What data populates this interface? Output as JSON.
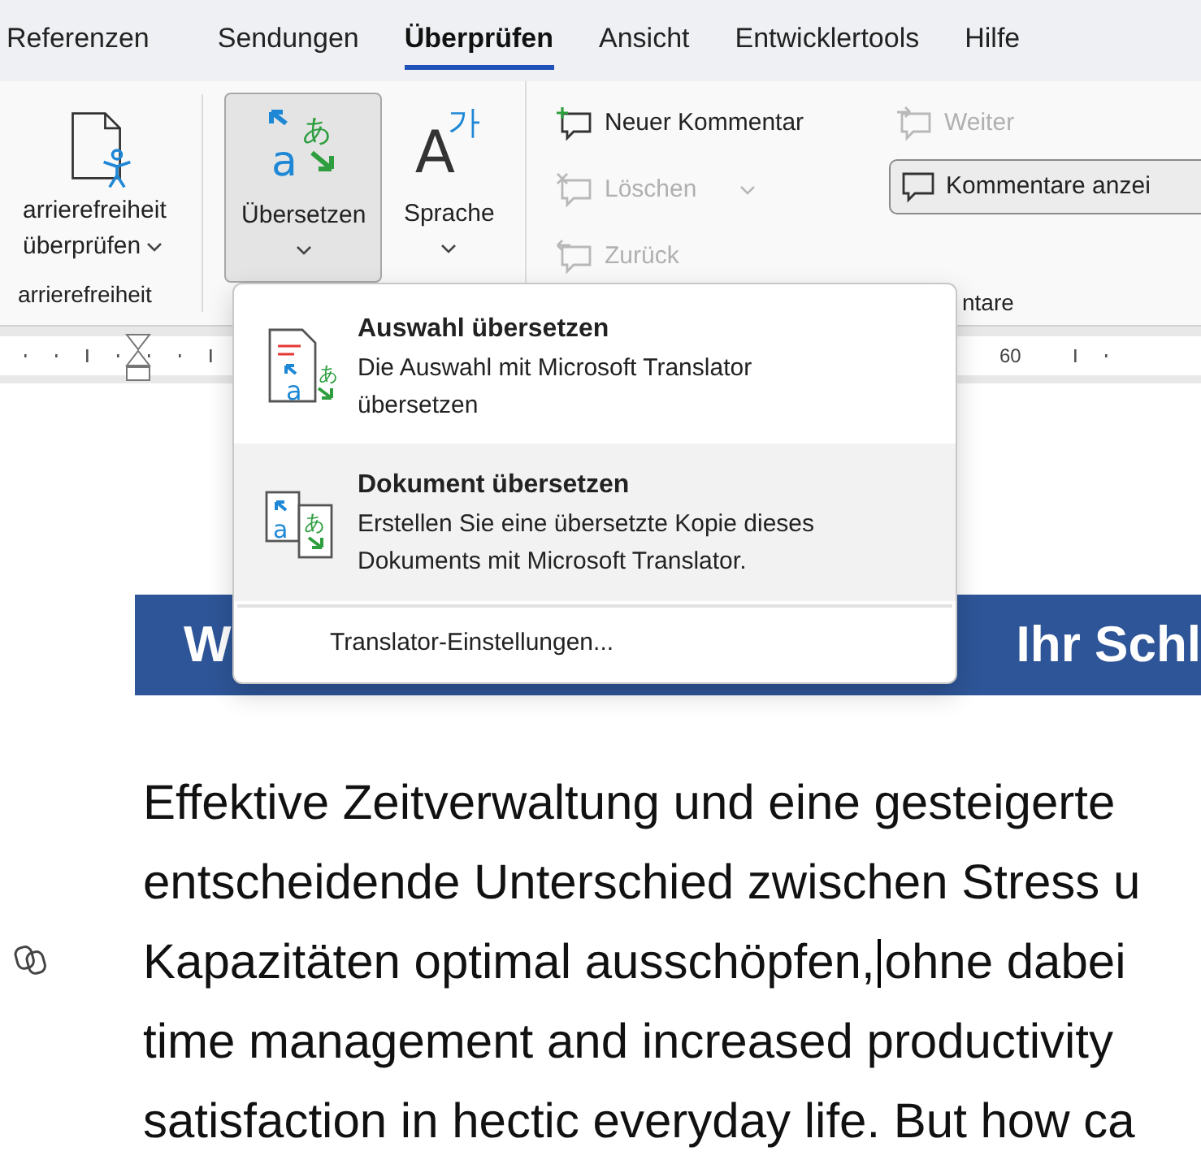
{
  "tabs": [
    {
      "label": "Referenzen",
      "selected": false
    },
    {
      "label": "Sendungen",
      "selected": false
    },
    {
      "label": "Überprüfen",
      "selected": true
    },
    {
      "label": "Ansicht",
      "selected": false
    },
    {
      "label": "Entwicklertools",
      "selected": false
    },
    {
      "label": "Hilfe",
      "selected": false
    }
  ],
  "ribbon": {
    "accessibility": {
      "label_line_1": "arrierefreiheit",
      "label_line_2": "überprüfen",
      "group_label": "arrierefreiheit"
    },
    "translate": {
      "label": "Übersetzen",
      "pressed": true,
      "icon_source": "a",
      "icon_target": "あ"
    },
    "language": {
      "label": "Sprache",
      "glyph": "가",
      "icon_letter": "A"
    },
    "comments": [
      {
        "kind": "new",
        "label": "Neuer Kommentar",
        "disabled": false
      },
      {
        "kind": "delete",
        "label": "Löschen",
        "disabled": true
      },
      {
        "kind": "back",
        "label": "Zurück",
        "disabled": true
      },
      {
        "kind": "next",
        "label": "Weiter",
        "disabled": true
      }
    ],
    "show_comments": {
      "label": "Kommentare anzei"
    },
    "comments_group_label": "ntare"
  },
  "ruler": {
    "tick_label": "60"
  },
  "menu": {
    "items": [
      {
        "kind": "selection",
        "title": "Auswahl übersetzen",
        "description": "Die Auswahl mit Microsoft Translator übersetzen",
        "selected": false,
        "icon_source": "a",
        "icon_target": "あ"
      },
      {
        "kind": "document",
        "title": "Dokument übersetzen",
        "description": "Erstellen Sie eine übersetzte Kopie dieses Dokuments mit Microsoft Translator.",
        "selected": true,
        "icon_source": "a",
        "icon_target": "あ"
      }
    ],
    "settings": "Translator-Einstellungen..."
  },
  "document": {
    "heading_left": "W",
    "heading_right": "Ihr Schl",
    "lines": [
      {
        "text": "Effektive Zeitverwaltung und eine gesteigerte",
        "cursor": false
      },
      {
        "text": "entscheidende Unterschied zwischen Stress u",
        "cursor": false
      },
      {
        "text": "Kapazitäten optimal ausschöpfen,",
        "cursor": true,
        "text_after": "ohne dabei"
      },
      {
        "text": "time management and increased productivity",
        "cursor": false
      },
      {
        "text": "satisfaction in hectic everyday life. But how ca",
        "cursor": false
      }
    ]
  }
}
